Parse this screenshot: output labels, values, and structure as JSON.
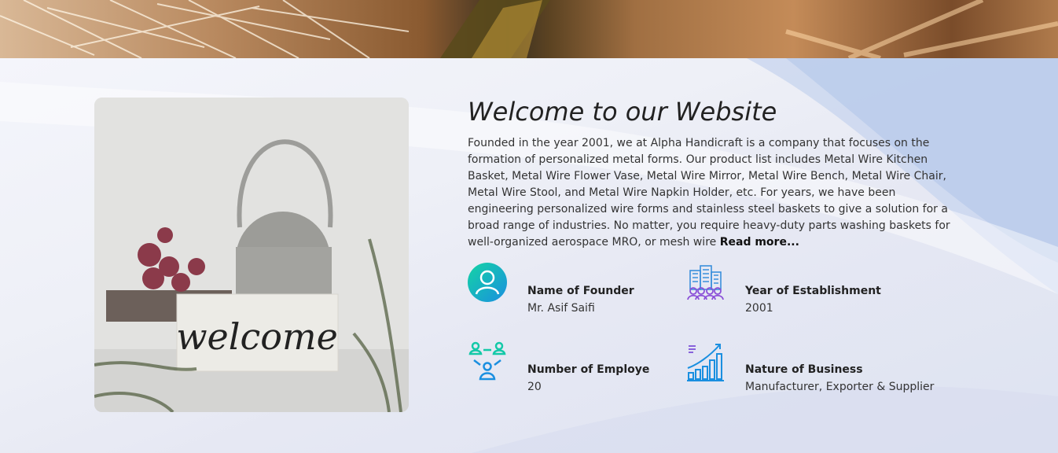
{
  "about": {
    "title": "Welcome to our Website",
    "intro": "Founded in the year 2001, we at Alpha Handicraft is a company that focuses on the formation of personalized metal forms. Our product list includes Metal Wire Kitchen Basket, Metal Wire Flower Vase, Metal Wire Mirror, Metal Wire Bench, Metal Wire Chair, Metal Wire Stool, and Metal Wire Napkin Holder, etc. For years, we have been engineering personalized wire forms and stainless steel baskets to give a solution for a broad range of industries. No matter, you require heavy-duty parts washing baskets for well-organized aerospace MRO, or mesh wire",
    "read_more": "Read more...",
    "image_text": "welcome"
  },
  "facts": [
    {
      "label": "Name of Founder",
      "value": "Mr. Asif Saifi",
      "icon": "founder-icon"
    },
    {
      "label": "Year of Establishment",
      "value": "2001",
      "icon": "building-icon"
    },
    {
      "label": "Number of Employe",
      "value": "20",
      "icon": "team-icon"
    },
    {
      "label": "Nature of Business",
      "value": "Manufacturer, Exporter & Supplier",
      "icon": "growth-chart-icon"
    }
  ],
  "colors": {
    "accent_teal": "#14c9a8",
    "accent_blue": "#1a8fe0",
    "accent_purple": "#7b4fd8"
  }
}
